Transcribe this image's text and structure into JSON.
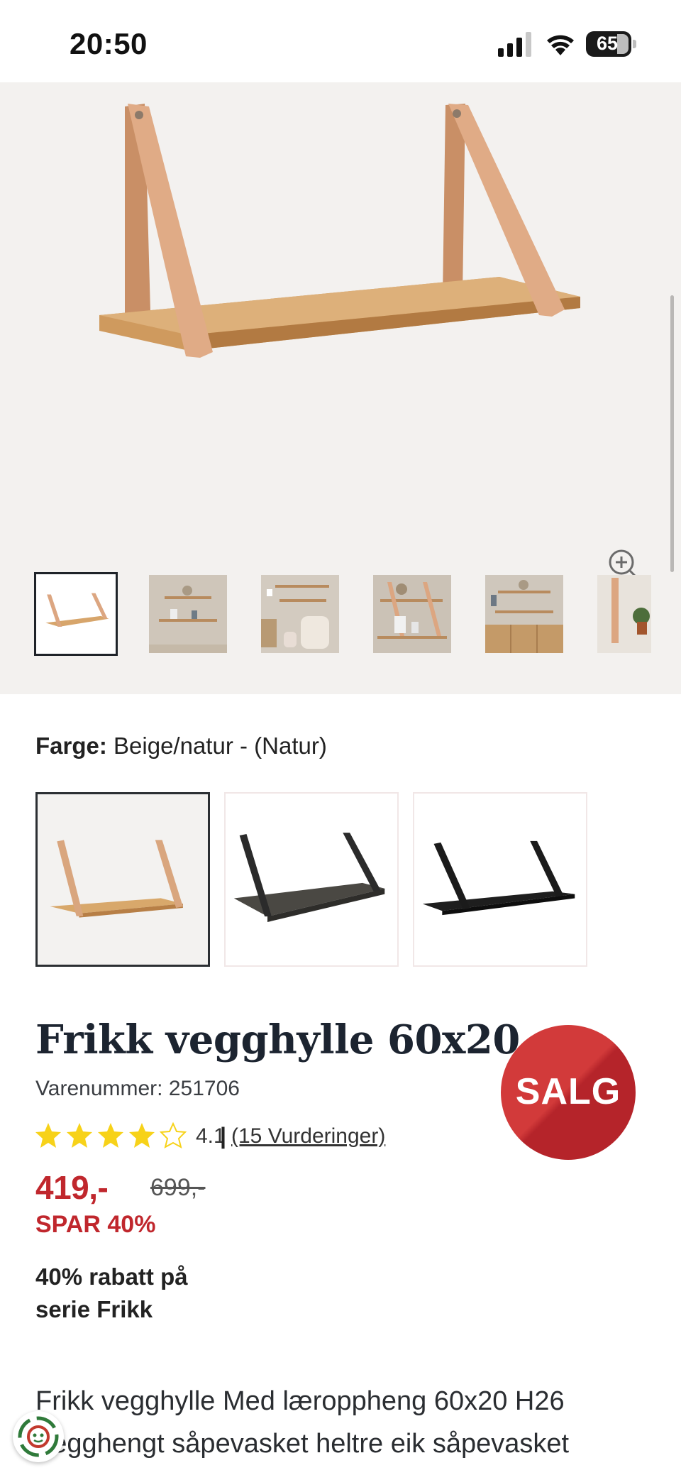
{
  "status_bar": {
    "time": "20:50",
    "battery_level": "65",
    "icons": [
      "signal-icon",
      "wifi-icon",
      "battery-icon"
    ]
  },
  "gallery": {
    "thumbnail_count": 6,
    "active_thumbnail": 1,
    "icons": [
      "zoom-in-icon"
    ]
  },
  "color": {
    "label": "Farge:",
    "value": "Beige/natur - (Natur)",
    "options": [
      {
        "id": "natur",
        "strap_color": "#d9a67e",
        "board_color": "#d8a86b",
        "selected": true
      },
      {
        "id": "dark-wood",
        "strap_color": "#2b2b2b",
        "board_color": "#4a4843",
        "selected": false
      },
      {
        "id": "black",
        "strap_color": "#1b1b1b",
        "board_color": "#1e1e1e",
        "selected": false
      }
    ]
  },
  "product": {
    "title": "Frikk vegghylle 60x20",
    "sku": "Varenummer: 251706",
    "badge": "SALG",
    "rating": {
      "stars": 4,
      "max": 5,
      "score": "4.1",
      "separator": "|",
      "reviews": "(15 Vurderinger)"
    },
    "price": "419,-",
    "old_price": "699,-",
    "discount": "SPAR 40%",
    "promo": "40% rabatt på serie Frikk",
    "description": "Frikk vegghylle Med læroppheng 60x20 H26 Vegghengt såpevasket heltre eik såpevasket"
  },
  "colors": {
    "sale_red": "#c0272d",
    "star_yellow": "#f7d219",
    "gallery_bg": "#f3f1ef",
    "text_dark": "#1c2430"
  },
  "chat": {
    "icon": "chat-assistant-icon"
  }
}
